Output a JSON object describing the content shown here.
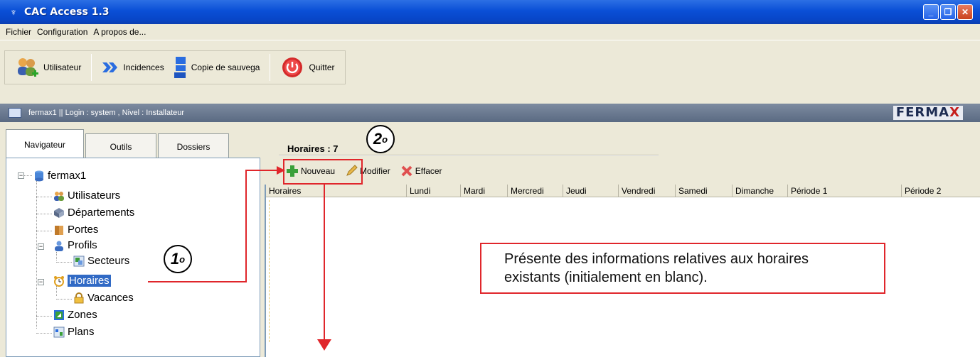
{
  "window": {
    "title": "CAC Access 1.3",
    "app_icon": "antenna-icon"
  },
  "menu": [
    "Fichier",
    "Configuration",
    "A propos de..."
  ],
  "toolbar": {
    "utilisateur": "Utilisateur",
    "incidences": "Incidences",
    "copie": "Copie de sauvega",
    "quitter": "Quitter"
  },
  "infobar": {
    "text": "fermax1  || Login : system , Nivel : Installateur",
    "logo": "FERMAX"
  },
  "tabs": [
    "Navigateur",
    "Outils",
    "Dossiers"
  ],
  "tree": {
    "root": "fermax1",
    "utilisateurs": "Utilisateurs",
    "departements": "Départements",
    "portes": "Portes",
    "profils": "Profils",
    "secteurs": "Secteurs",
    "horaires": "Horaires",
    "vacances": "Vacances",
    "zones": "Zones",
    "plans": "Plans"
  },
  "main": {
    "count_label": "Horaires : 7",
    "actions": {
      "nouveau": "Nouveau",
      "modifier": "Modifier",
      "effacer": "Effacer"
    },
    "columns": [
      "Horaires",
      "Lundi",
      "Mardi",
      "Mercredi",
      "Jeudi",
      "Vendredi",
      "Samedi",
      "Dimanche",
      "Période 1",
      "Période 2"
    ]
  },
  "annotations": {
    "step1": "1",
    "step2": "2",
    "superscript": "o",
    "callout_line1": "Présente des informations relatives aux horaires",
    "callout_line2": "existants (initialement en blanc).",
    "accent_color": "#e0262b"
  }
}
